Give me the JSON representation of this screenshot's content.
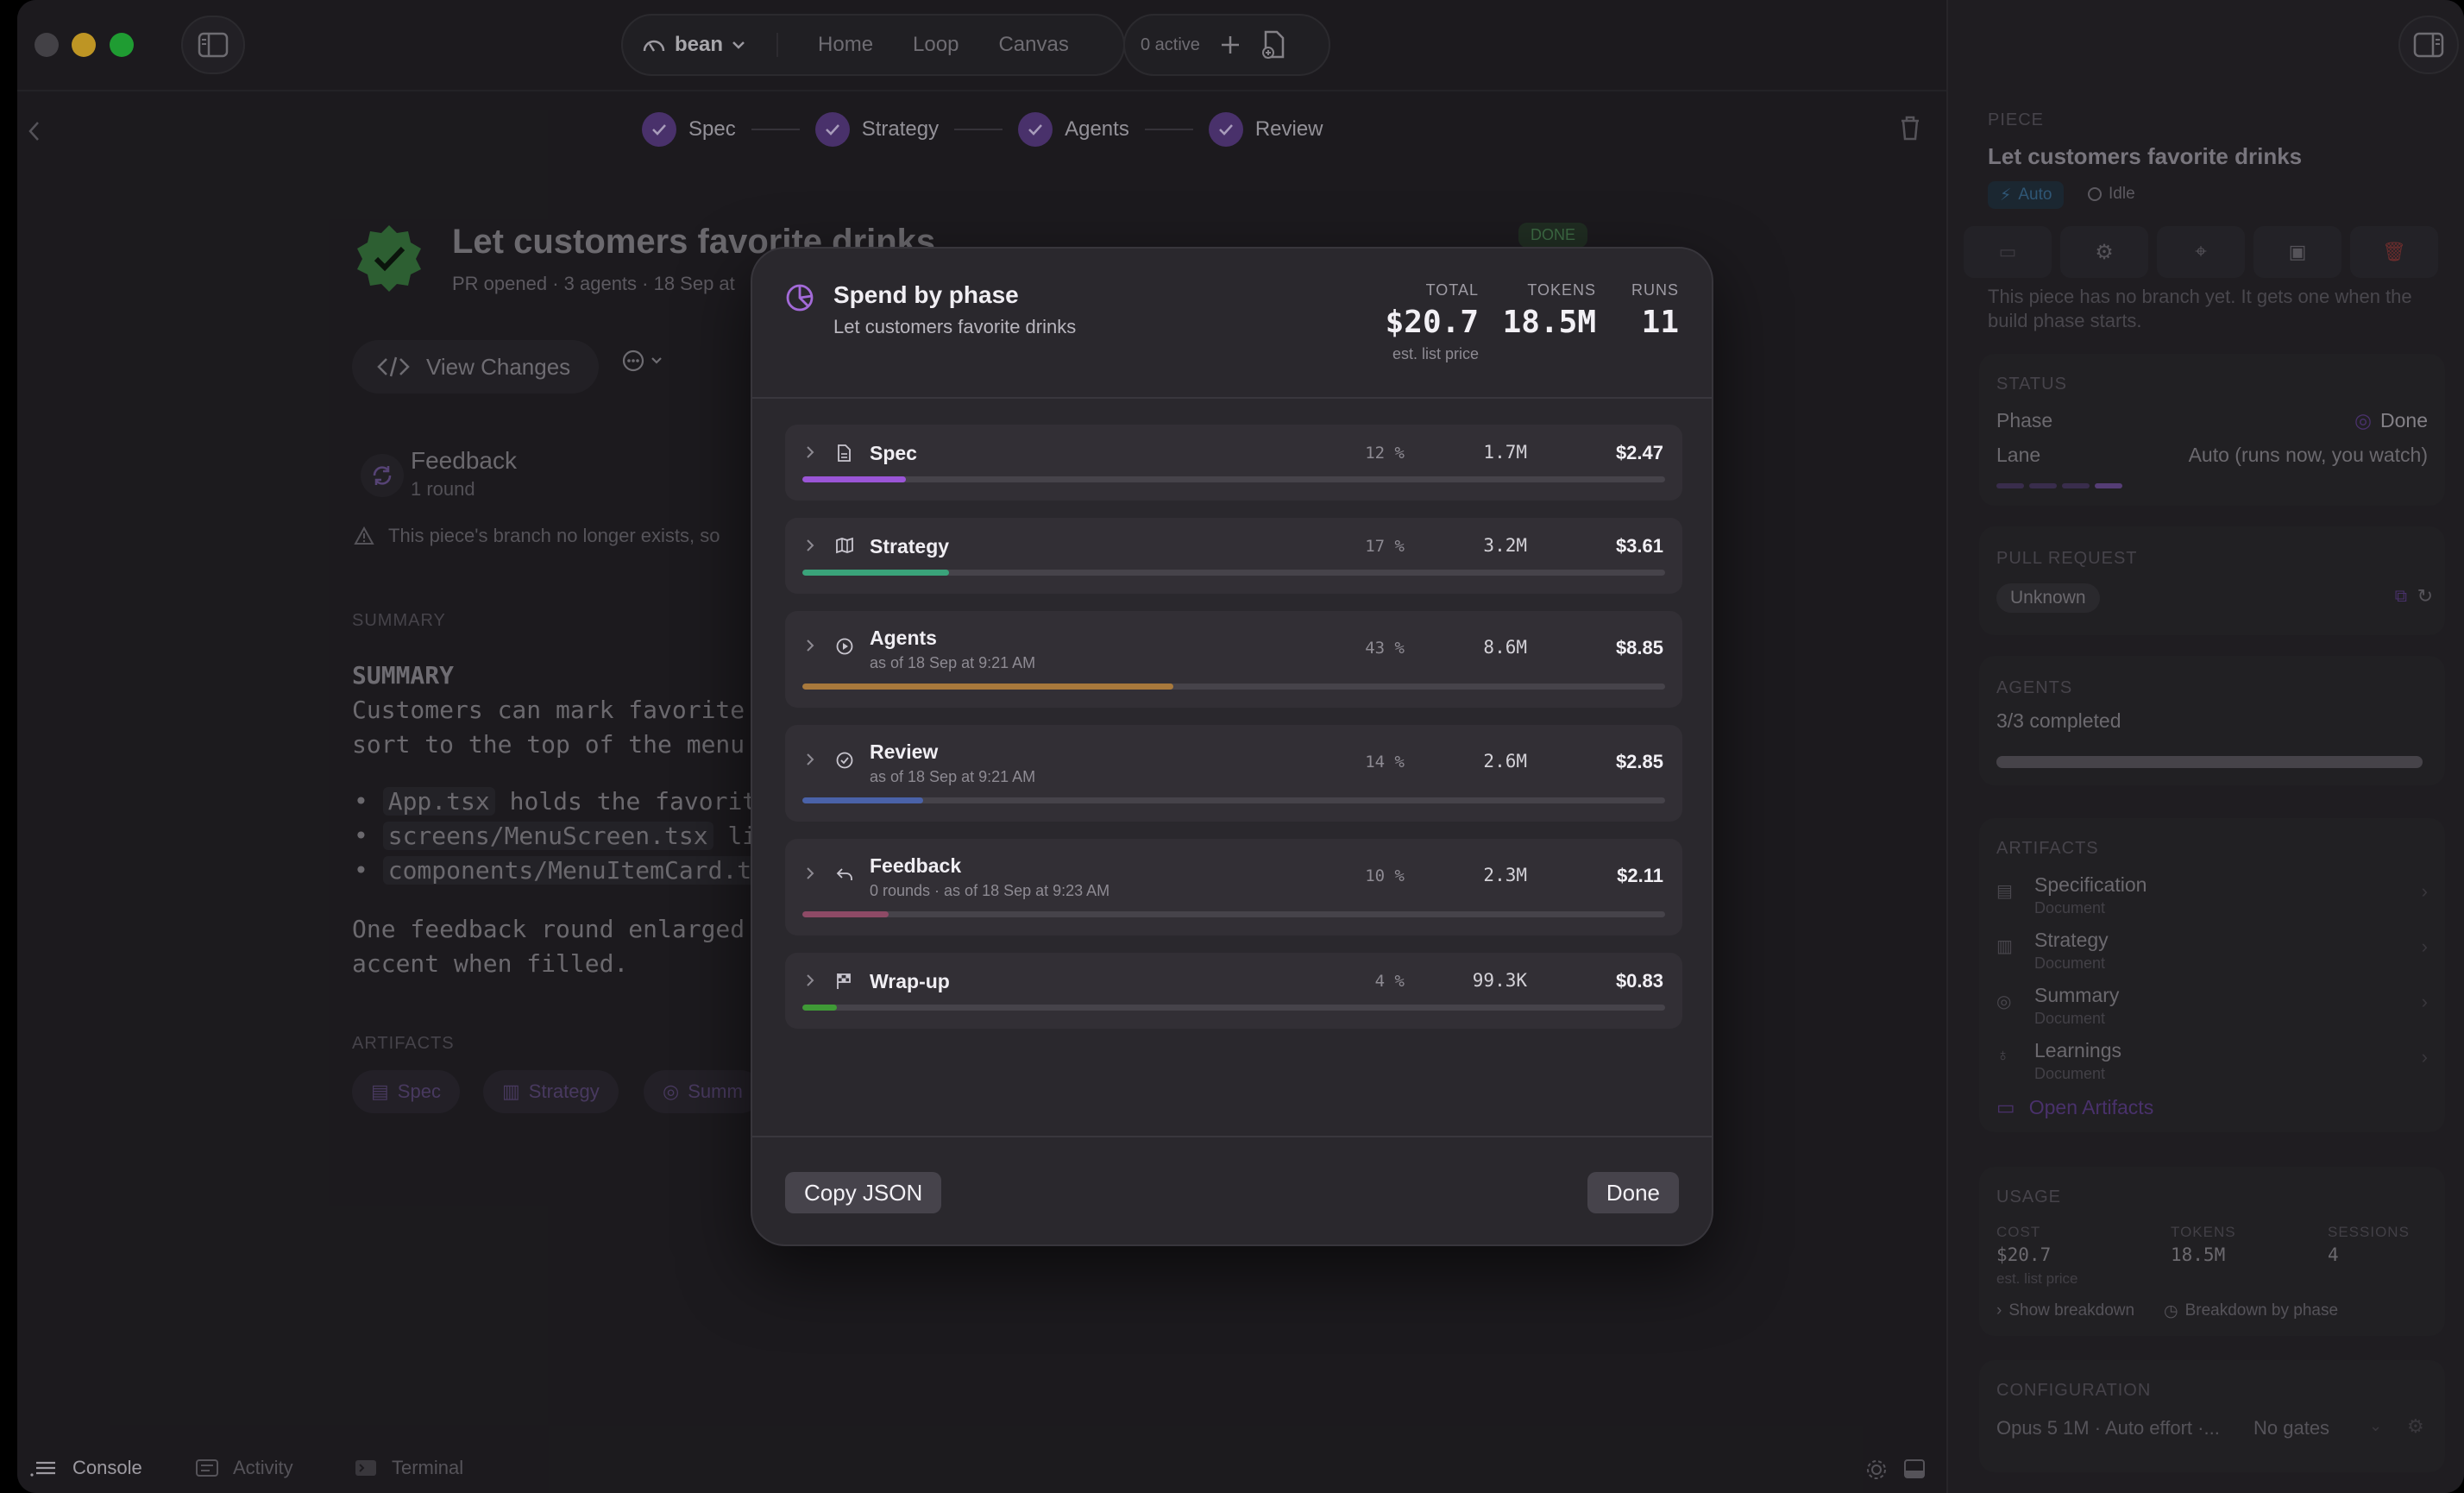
{
  "toolbar": {
    "project": "bean",
    "nav": [
      "Home",
      "Loop",
      "Canvas"
    ],
    "active_count": "0 active"
  },
  "stepper": {
    "steps": [
      "Spec",
      "Strategy",
      "Agents",
      "Review"
    ]
  },
  "piece": {
    "title": "Let customers favorite drinks",
    "status_chip": "DONE",
    "subtitle": "PR opened · 3 agents · 18 Sep at",
    "view_changes": "View Changes",
    "feedback_title": "Feedback",
    "feedback_sub": "1 round",
    "warning": "This piece's branch no longer exists, so",
    "summary_section": "SUMMARY",
    "summary_heading": "SUMMARY",
    "summary_lines": [
      "Customers can mark favorite dr",
      "sort to the top of the menu fo"
    ],
    "bullets": [
      {
        "code": "App.tsx",
        "text": " holds the favorites"
      },
      {
        "code": "screens/MenuScreen.tsx",
        "text": " lists"
      },
      {
        "code": "components/MenuItemCard.tsx",
        "text": " g"
      }
    ],
    "closing_lines": [
      "One feedback round enlarged th",
      "accent when filled."
    ],
    "artifacts_section": "ARTIFACTS",
    "artifact_chips": [
      "Spec",
      "Strategy",
      "Summ"
    ]
  },
  "bottombar": {
    "console": "Console",
    "activity": "Activity",
    "terminal": "Terminal"
  },
  "right": {
    "piece_label": "PIECE",
    "title": "Let customers favorite drinks",
    "auto": "Auto",
    "idle": "Idle",
    "note": "This piece has no branch yet. It gets one when the build phase starts.",
    "status_label": "STATUS",
    "phase_label": "Phase",
    "phase_value": "Done",
    "lane_label": "Lane",
    "lane_value": "Auto (runs now, you watch)",
    "pr_label": "PULL REQUEST",
    "pr_value": "Unknown",
    "agents_label": "AGENTS",
    "agents_value": "3/3 completed",
    "artifacts_label": "ARTIFACTS",
    "artifacts": [
      {
        "name": "Specification",
        "type": "Document"
      },
      {
        "name": "Strategy",
        "type": "Document"
      },
      {
        "name": "Summary",
        "type": "Document"
      },
      {
        "name": "Learnings",
        "type": "Document"
      }
    ],
    "open_artifacts": "Open Artifacts",
    "usage_label": "USAGE",
    "cost_label": "COST",
    "cost_value": "$20.7",
    "cost_note": "est. list price",
    "tokens_label": "TOKENS",
    "tokens_value": "18.5M",
    "sessions_label": "SESSIONS",
    "sessions_value": "4",
    "show_breakdown": "Show breakdown",
    "breakdown_by_phase": "Breakdown by phase",
    "config_label": "CONFIGURATION",
    "config_value": "Opus 5 1M · Auto effort ·...",
    "gates_value": "No gates"
  },
  "modal": {
    "title": "Spend by phase",
    "subtitle": "Let customers favorite drinks",
    "total_label": "TOTAL",
    "total_value": "$20.7",
    "total_note": "est. list price",
    "tokens_label": "TOKENS",
    "tokens_value": "18.5M",
    "runs_label": "RUNS",
    "runs_value": "11",
    "copy_json": "Copy JSON",
    "done": "Done",
    "phases": [
      {
        "name": "Spec",
        "sub": "",
        "pct": "12 %",
        "share": 12,
        "tokens": "1.7M",
        "cost": "$2.47",
        "color": "#9a55d6",
        "icon": "document-icon"
      },
      {
        "name": "Strategy",
        "sub": "",
        "pct": "17 %",
        "share": 17,
        "tokens": "3.2M",
        "cost": "$3.61",
        "color": "#3aa37a",
        "icon": "map-icon"
      },
      {
        "name": "Agents",
        "sub": "as of 18 Sep at 9:21 AM",
        "pct": "43 %",
        "share": 43,
        "tokens": "8.6M",
        "cost": "$8.85",
        "color": "#a8793c",
        "icon": "play-circle-icon"
      },
      {
        "name": "Review",
        "sub": "as of 18 Sep at 9:21 AM",
        "pct": "14 %",
        "share": 14,
        "tokens": "2.6M",
        "cost": "$2.85",
        "color": "#4a62a8",
        "icon": "check-circle-icon"
      },
      {
        "name": "Feedback",
        "sub": "0 rounds · as of 18 Sep at 9:23 AM",
        "pct": "10 %",
        "share": 10,
        "tokens": "2.3M",
        "cost": "$2.11",
        "color": "#8e4a66",
        "icon": "reply-icon"
      },
      {
        "name": "Wrap-up",
        "sub": "",
        "pct": "4 %",
        "share": 4,
        "tokens": "99.3K",
        "cost": "$0.83",
        "color": "#3f9a36",
        "icon": "flag-icon"
      }
    ]
  }
}
